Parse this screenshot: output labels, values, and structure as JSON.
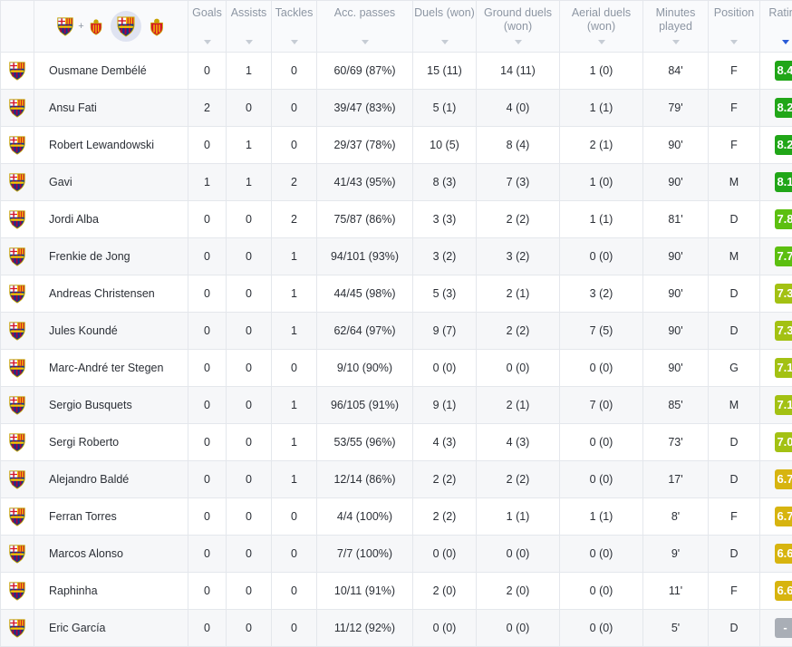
{
  "filters": {
    "combined_plus": "+"
  },
  "columns": [
    {
      "key": "goals",
      "label": "Goals"
    },
    {
      "key": "assists",
      "label": "Assists"
    },
    {
      "key": "tackles",
      "label": "Tackles"
    },
    {
      "key": "passes",
      "label": "Acc. passes"
    },
    {
      "key": "duels",
      "label": "Duels (won)"
    },
    {
      "key": "ground",
      "label": "Ground duels (won)"
    },
    {
      "key": "aerial",
      "label": "Aerial duels (won)"
    },
    {
      "key": "minutes",
      "label": "Minutes played"
    },
    {
      "key": "position",
      "label": "Position"
    },
    {
      "key": "rating",
      "label": "Rating"
    }
  ],
  "colors": {
    "rating_dark_green": "#21a618",
    "rating_green": "#5cbf10",
    "rating_yellow_green": "#a3c113",
    "rating_yellow": "#d7b40f",
    "rating_none": "#a9aeb6",
    "sort_active": "#2a5bd7"
  },
  "players": [
    {
      "name": "Ousmane Dembélé",
      "goals": "0",
      "assists": "1",
      "tackles": "0",
      "passes": "60/69 (87%)",
      "duels": "15 (11)",
      "ground": "14 (11)",
      "aerial": "1 (0)",
      "minutes": "84'",
      "position": "F",
      "rating": "8.4",
      "rating_color": "#21a618"
    },
    {
      "name": "Ansu Fati",
      "goals": "2",
      "assists": "0",
      "tackles": "0",
      "passes": "39/47 (83%)",
      "duels": "5 (1)",
      "ground": "4 (0)",
      "aerial": "1 (1)",
      "minutes": "79'",
      "position": "F",
      "rating": "8.2",
      "rating_color": "#21a618"
    },
    {
      "name": "Robert Lewandowski",
      "goals": "0",
      "assists": "1",
      "tackles": "0",
      "passes": "29/37 (78%)",
      "duels": "10 (5)",
      "ground": "8 (4)",
      "aerial": "2 (1)",
      "minutes": "90'",
      "position": "F",
      "rating": "8.2",
      "rating_color": "#21a618"
    },
    {
      "name": "Gavi",
      "goals": "1",
      "assists": "1",
      "tackles": "2",
      "passes": "41/43 (95%)",
      "duels": "8 (3)",
      "ground": "7 (3)",
      "aerial": "1 (0)",
      "minutes": "90'",
      "position": "M",
      "rating": "8.1",
      "rating_color": "#21a618"
    },
    {
      "name": "Jordi Alba",
      "goals": "0",
      "assists": "0",
      "tackles": "2",
      "passes": "75/87 (86%)",
      "duels": "3 (3)",
      "ground": "2 (2)",
      "aerial": "1 (1)",
      "minutes": "81'",
      "position": "D",
      "rating": "7.8",
      "rating_color": "#5cbf10"
    },
    {
      "name": "Frenkie de Jong",
      "goals": "0",
      "assists": "0",
      "tackles": "1",
      "passes": "94/101 (93%)",
      "duels": "3 (2)",
      "ground": "3 (2)",
      "aerial": "0 (0)",
      "minutes": "90'",
      "position": "M",
      "rating": "7.7",
      "rating_color": "#5cbf10"
    },
    {
      "name": "Andreas Christensen",
      "goals": "0",
      "assists": "0",
      "tackles": "1",
      "passes": "44/45 (98%)",
      "duels": "5 (3)",
      "ground": "2 (1)",
      "aerial": "3 (2)",
      "minutes": "90'",
      "position": "D",
      "rating": "7.3",
      "rating_color": "#a3c113"
    },
    {
      "name": "Jules Koundé",
      "goals": "0",
      "assists": "0",
      "tackles": "1",
      "passes": "62/64 (97%)",
      "duels": "9 (7)",
      "ground": "2 (2)",
      "aerial": "7 (5)",
      "minutes": "90'",
      "position": "D",
      "rating": "7.3",
      "rating_color": "#a3c113"
    },
    {
      "name": "Marc-André ter Stegen",
      "goals": "0",
      "assists": "0",
      "tackles": "0",
      "passes": "9/10 (90%)",
      "duels": "0 (0)",
      "ground": "0 (0)",
      "aerial": "0 (0)",
      "minutes": "90'",
      "position": "G",
      "rating": "7.1",
      "rating_color": "#a3c113"
    },
    {
      "name": "Sergio Busquets",
      "goals": "0",
      "assists": "0",
      "tackles": "1",
      "passes": "96/105 (91%)",
      "duels": "9 (1)",
      "ground": "2 (1)",
      "aerial": "7 (0)",
      "minutes": "85'",
      "position": "M",
      "rating": "7.1",
      "rating_color": "#a3c113"
    },
    {
      "name": "Sergi Roberto",
      "goals": "0",
      "assists": "0",
      "tackles": "1",
      "passes": "53/55 (96%)",
      "duels": "4 (3)",
      "ground": "4 (3)",
      "aerial": "0 (0)",
      "minutes": "73'",
      "position": "D",
      "rating": "7.0",
      "rating_color": "#a3c113"
    },
    {
      "name": "Alejandro Baldé",
      "goals": "0",
      "assists": "0",
      "tackles": "1",
      "passes": "12/14 (86%)",
      "duels": "2 (2)",
      "ground": "2 (2)",
      "aerial": "0 (0)",
      "minutes": "17'",
      "position": "D",
      "rating": "6.7",
      "rating_color": "#d7b40f"
    },
    {
      "name": "Ferran Torres",
      "goals": "0",
      "assists": "0",
      "tackles": "0",
      "passes": "4/4 (100%)",
      "duels": "2 (2)",
      "ground": "1 (1)",
      "aerial": "1 (1)",
      "minutes": "8'",
      "position": "F",
      "rating": "6.7",
      "rating_color": "#d7b40f"
    },
    {
      "name": "Marcos Alonso",
      "goals": "0",
      "assists": "0",
      "tackles": "0",
      "passes": "7/7 (100%)",
      "duels": "0 (0)",
      "ground": "0 (0)",
      "aerial": "0 (0)",
      "minutes": "9'",
      "position": "D",
      "rating": "6.6",
      "rating_color": "#d7b40f"
    },
    {
      "name": "Raphinha",
      "goals": "0",
      "assists": "0",
      "tackles": "0",
      "passes": "10/11 (91%)",
      "duels": "2 (0)",
      "ground": "2 (0)",
      "aerial": "0 (0)",
      "minutes": "11'",
      "position": "F",
      "rating": "6.6",
      "rating_color": "#d7b40f"
    },
    {
      "name": "Eric García",
      "goals": "0",
      "assists": "0",
      "tackles": "0",
      "passes": "11/12 (92%)",
      "duels": "0 (0)",
      "ground": "0 (0)",
      "aerial": "0 (0)",
      "minutes": "5'",
      "position": "D",
      "rating": "-",
      "rating_color": "#a9aeb6"
    }
  ]
}
